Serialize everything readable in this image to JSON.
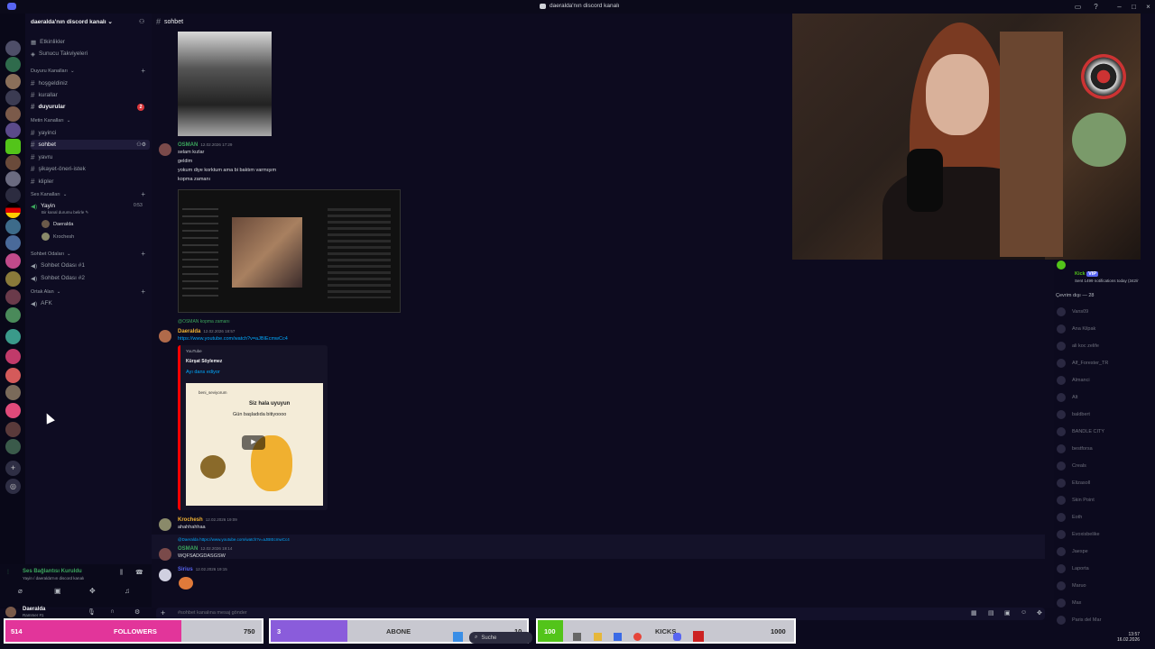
{
  "window": {
    "title": "daeralda'nın discord kanalı"
  },
  "server": {
    "name": "daeralda'nın discord kanalı"
  },
  "sidebar": {
    "top_items": [
      "Etkinlikler",
      "Sunucu Takviyeleri"
    ],
    "categories": [
      {
        "name": "Duyuru Kanalları",
        "channels": [
          "hoşgeldiniz",
          "kurallar",
          "duyurular"
        ]
      },
      {
        "name": "Metin Kanalları",
        "channels": [
          "yayinci",
          "sohbet",
          "yavru",
          "şikayet-öneri-istek",
          "klipler"
        ]
      },
      {
        "name": "Ses Kanalları",
        "channels": [
          "Yayin"
        ]
      },
      {
        "name": "Sohbet Odaları",
        "channels": [
          "Sohbet Odası #1",
          "Sohbet Odası #2"
        ]
      },
      {
        "name": "Ortak Alan",
        "channels": [
          "AFK"
        ]
      }
    ],
    "duyurular_badge": "2",
    "voice_status": "Bir kanal durumu belirle",
    "voice_time": "0:53",
    "voice_users": [
      "Daeralda",
      "Krochesh"
    ]
  },
  "voice_panel": {
    "status": "Ses Bağlantısı Kuruldu",
    "sub": "Yayin / daeralda'nın discord kanalı",
    "user": "Daeralda",
    "user_sub": "Rammer #1"
  },
  "chat": {
    "channel": "sohbet",
    "input_placeholder": "#sohbet kanalına mesaj gönder",
    "messages": [
      {
        "user": "OSMAN",
        "time": "12.02.2026 17:29",
        "color": "#3ba55c",
        "lines": [
          "selam kızlar",
          "geldim",
          "yokum diye korktum ama bi baktım varmışım",
          "kopma zamanı"
        ]
      },
      {
        "reply": "@OSMAN kopma zamanı",
        "user": "Daeralda",
        "time": "12.02.2026 18:57",
        "color": "#f0b232",
        "link": "https://www.youtube.com/watch?v=aJBIEcmwCc4",
        "embed": {
          "provider": "YouTube",
          "author": "Kürşat Söylemez",
          "title": "Ayı dans ediyor",
          "thumb_label": "beni_seviyorum",
          "thumb_text1": "Siz hala uyuyun",
          "thumb_text2": "Gün başladıda bitiyoooo"
        }
      },
      {
        "user": "Krochesh",
        "time": "12.02.2026 19:09",
        "color": "#f0b232",
        "lines": [
          "ahahhahhaa"
        ]
      },
      {
        "reply": "@Daeralda https://www.youtube.com/watch?v=aJBIEcmwCc4",
        "user": "OSMAN",
        "time": "12.02.2026 19:14",
        "color": "#3ba55c",
        "lines": [
          "WQFSADGDASGSW"
        ]
      },
      {
        "user": "Sirius",
        "time": "12.02.2026 19:15",
        "color": "#5865f2",
        "lines": []
      }
    ]
  },
  "stream_chat": {
    "notice_top": "Kick",
    "notice_sub": "Sent 1499 notifications today (342/r",
    "online_header": "Çevrim dışı — 28",
    "viewers": [
      "Vans09",
      "Ana Kilpak",
      "ali koc zelife",
      "Alf_Forester_TR",
      "Almanci",
      "Alt",
      "baldbert",
      "BANDLE CITY",
      "bestforsa",
      "Creals",
      "Elizasoll",
      "Skin Point",
      "Eoth",
      "Evoxisbelike",
      "Jaespe",
      "Laporta",
      "Maruo",
      "Max",
      "Paris del Mar"
    ]
  },
  "goals": {
    "followers": {
      "current": "514",
      "label": "FOLLOWERS",
      "target": "750",
      "progress": 0.685,
      "color": "#e2359a"
    },
    "abone": {
      "current": "3",
      "label": "ABONE",
      "target": "10",
      "progress": 0.3,
      "color": "#8a5cdb"
    },
    "kicks": {
      "current": "100",
      "label": "KICKS",
      "target": "1000",
      "progress": 0.1,
      "color": "#53c41a"
    }
  },
  "taskbar": {
    "search": "Suche",
    "time": "13:57",
    "date": "16.02.2026"
  }
}
